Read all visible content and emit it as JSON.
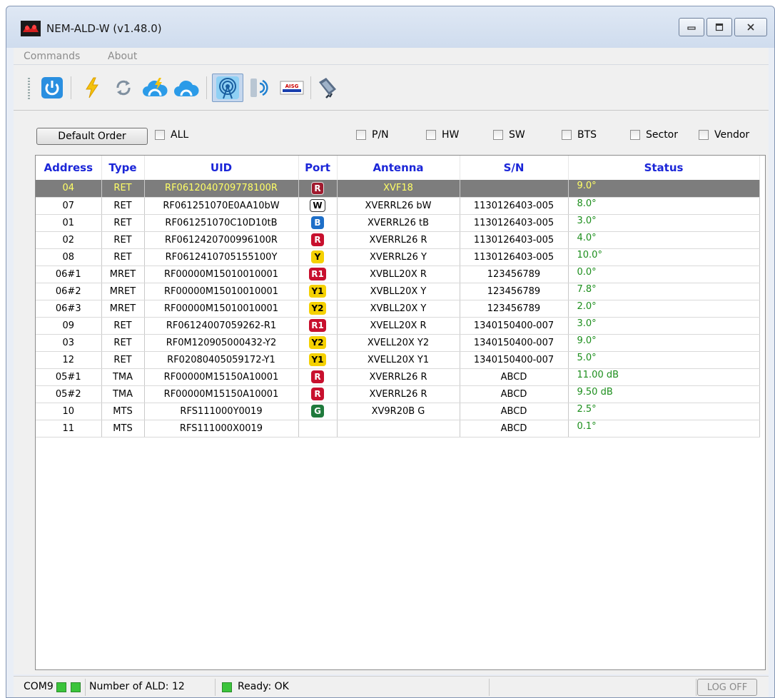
{
  "window": {
    "title": "NEM-ALD-W (v1.48.0)"
  },
  "menu": {
    "items": [
      "Commands",
      "About"
    ]
  },
  "toolbar": {
    "buttons": [
      "power-icon",
      "lightning-icon",
      "refresh-icon",
      "cloud-lightning-icon",
      "cloud-icon",
      "antenna-icon",
      "signal-icon",
      "aisg-icon",
      "connector-icon"
    ],
    "aisg_label": "AISG"
  },
  "controls": {
    "default_order": "Default Order",
    "filters": [
      {
        "label": "ALL",
        "checked": false
      },
      {
        "label": "P/N",
        "checked": false
      },
      {
        "label": "HW",
        "checked": false
      },
      {
        "label": "SW",
        "checked": false
      },
      {
        "label": "BTS",
        "checked": false
      },
      {
        "label": "Sector",
        "checked": false
      },
      {
        "label": "Vendor",
        "checked": false
      }
    ]
  },
  "table": {
    "headers": [
      "Address",
      "Type",
      "UID",
      "Port",
      "Antenna",
      "S/N",
      "Status"
    ],
    "rows": [
      {
        "address": "04",
        "type": "RET",
        "uid": "RF0612040709778100R",
        "port": "R",
        "port_color": "red-sel",
        "antenna": "XVF18",
        "sn": "",
        "status": "9.0°",
        "selected": true
      },
      {
        "address": "07",
        "type": "RET",
        "uid": "RF061251070E0AA10bW",
        "port": "W",
        "port_color": "white",
        "antenna": "XVERRL26 bW",
        "sn": "1130126403-005",
        "status": "8.0°"
      },
      {
        "address": "01",
        "type": "RET",
        "uid": "RF061251070C10D10tB",
        "port": "B",
        "port_color": "blue",
        "antenna": "XVERRL26 tB",
        "sn": "1130126403-005",
        "status": "3.0°"
      },
      {
        "address": "02",
        "type": "RET",
        "uid": "RF0612420700996100R",
        "port": "R",
        "port_color": "red",
        "antenna": "XVERRL26 R",
        "sn": "1130126403-005",
        "status": "4.0°"
      },
      {
        "address": "08",
        "type": "RET",
        "uid": "RF0612410705155100Y",
        "port": "Y",
        "port_color": "yellow",
        "antenna": "XVERRL26 Y",
        "sn": "1130126403-005",
        "status": "10.0°"
      },
      {
        "address": "06#1",
        "type": "MRET",
        "uid": "RF00000M15010010001",
        "port": "R1",
        "port_color": "red",
        "antenna": "XVBLL20X R",
        "sn": "123456789",
        "status": "0.0°"
      },
      {
        "address": "06#2",
        "type": "MRET",
        "uid": "RF00000M15010010001",
        "port": "Y1",
        "port_color": "yellow",
        "antenna": "XVBLL20X Y",
        "sn": "123456789",
        "status": "7.8°"
      },
      {
        "address": "06#3",
        "type": "MRET",
        "uid": "RF00000M15010010001",
        "port": "Y2",
        "port_color": "yellow",
        "antenna": "XVBLL20X Y",
        "sn": "123456789",
        "status": "2.0°"
      },
      {
        "address": "09",
        "type": "RET",
        "uid": "RF06124007059262-R1",
        "port": "R1",
        "port_color": "red",
        "antenna": "XVELL20X R",
        "sn": "1340150400-007",
        "status": "3.0°"
      },
      {
        "address": "03",
        "type": "RET",
        "uid": "RF0M120905000432-Y2",
        "port": "Y2",
        "port_color": "yellow",
        "antenna": "XVELL20X Y2",
        "sn": "1340150400-007",
        "status": "9.0°"
      },
      {
        "address": "12",
        "type": "RET",
        "uid": "RF02080405059172-Y1",
        "port": "Y1",
        "port_color": "yellow",
        "antenna": "XVELL20X Y1",
        "sn": "1340150400-007",
        "status": "5.0°"
      },
      {
        "address": "05#1",
        "type": "TMA",
        "uid": "RF00000M15150A10001",
        "port": "R",
        "port_color": "red",
        "antenna": "XVERRL26 R",
        "sn": "ABCD",
        "status": "11.00 dB"
      },
      {
        "address": "05#2",
        "type": "TMA",
        "uid": "RF00000M15150A10001",
        "port": "R",
        "port_color": "red",
        "antenna": "XVERRL26 R",
        "sn": "ABCD",
        "status": "9.50 dB"
      },
      {
        "address": "10",
        "type": "MTS",
        "uid": "RFS111000Y0019",
        "port": "G",
        "port_color": "green",
        "antenna": "XV9R20B G",
        "sn": "ABCD",
        "status": "2.5°"
      },
      {
        "address": "11",
        "type": "MTS",
        "uid": "RFS111000X0019",
        "port": "",
        "port_color": "",
        "antenna": "",
        "sn": "ABCD",
        "status": "0.1°"
      }
    ]
  },
  "statusbar": {
    "port": "COM9",
    "ald_count": "Number of ALD: 12",
    "ready": "Ready: OK",
    "logoff": "LOG OFF"
  }
}
